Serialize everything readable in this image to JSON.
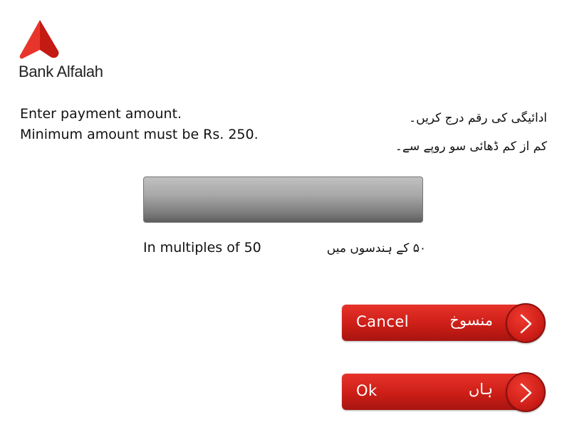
{
  "brand": {
    "name": "Bank Alfalah",
    "color": "#d8231b"
  },
  "instructions": {
    "en_line1": "Enter payment amount.",
    "en_line2": "Minimum amount must be Rs. 250.",
    "ur_line1": "ادائیگی کی رقم درج کریں۔",
    "ur_line2": "کم از کم ڈھائی سو روپے سے۔"
  },
  "amount_input": {
    "value": ""
  },
  "hint": {
    "en": "In multiples of 50",
    "ur": "۵۰ کے ہندسوں میں"
  },
  "buttons": {
    "cancel": {
      "en": "Cancel",
      "ur": "منسوخ",
      "icon": "chevron-right-icon"
    },
    "ok": {
      "en": "Ok",
      "ur": "ہاں",
      "icon": "chevron-right-icon"
    }
  },
  "colors": {
    "button_red": "#cc1e17",
    "field_gray": "#a8a8a8"
  }
}
